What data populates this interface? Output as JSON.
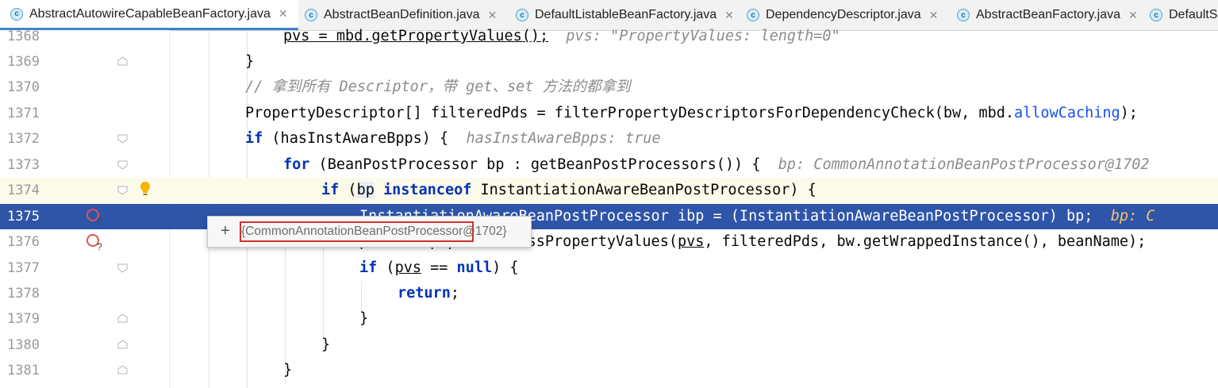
{
  "tabs": [
    {
      "label": "AbstractAutowireCapableBeanFactory.java",
      "active": true
    },
    {
      "label": "AbstractBeanDefinition.java",
      "active": false
    },
    {
      "label": "DefaultListableBeanFactory.java",
      "active": false
    },
    {
      "label": "DependencyDescriptor.java",
      "active": false
    },
    {
      "label": "AbstractBeanFactory.java",
      "active": false
    },
    {
      "label": "DefaultS",
      "active": false
    }
  ],
  "close_glyph": "✕",
  "class_icon_letter": "c",
  "lines": {
    "l1368": {
      "num": "1368",
      "code": "pvs = mbd.getPropertyValues();",
      "hint": "pvs: \"PropertyValues: length=0\""
    },
    "l1369": {
      "num": "1369",
      "code": "}"
    },
    "l1370": {
      "num": "1370",
      "comment": "// 拿到所有 Descriptor，带 get、set 方法的都拿到"
    },
    "l1371": {
      "num": "1371",
      "code_a": "PropertyDescriptor[] filteredPds = filterPropertyDescriptorsForDependencyCheck(bw, mbd.",
      "field": "allowCaching",
      "code_b": ");"
    },
    "l1372": {
      "num": "1372",
      "kw": "if",
      "code": " (hasInstAwareBpps) {",
      "hint": "hasInstAwareBpps: true"
    },
    "l1373": {
      "num": "1373",
      "kw": "for",
      "code": " (BeanPostProcessor bp : getBeanPostProcessors()) {",
      "hint": "bp: CommonAnnotationBeanPostProcessor@1702"
    },
    "l1374": {
      "num": "1374",
      "kw": "if",
      "code_a": " (",
      "var": "bp",
      "kw2": " instanceof",
      "code_b": " InstantiationAwareBeanPostProcessor) {"
    },
    "l1375": {
      "num": "1375",
      "code": "InstantiationAwareBeanPostProcessor ibp = (InstantiationAwareBeanPostProcessor) bp;",
      "hint": "bp: C"
    },
    "l1376": {
      "num": "1376",
      "code_a": "pvs",
      "code_b": " = ibp.postProcessPropertyValues(",
      "pvs_arg": "pvs",
      "code_c": ", filteredPds, bw.getWrappedInstance(), beanName);"
    },
    "l1377": {
      "num": "1377",
      "kw": "if",
      "code_a": " (",
      "var": "pvs",
      "code_b": " == ",
      "kw2": "null",
      "code_c": ") {"
    },
    "l1378": {
      "num": "1378",
      "kw": "return",
      "code": ";"
    },
    "l1379": {
      "num": "1379",
      "code": "}"
    },
    "l1380": {
      "num": "1380",
      "code": "}"
    },
    "l1381": {
      "num": "1381",
      "code": "}"
    }
  },
  "popup": {
    "expand": "+",
    "value": "{CommonAnnotationBeanPostProcessor@1702}"
  },
  "colors": {
    "keyword": "#0033b3",
    "selection": "#2e55a8",
    "current_line": "#fcfae9",
    "field": "#1750eb",
    "callout": "#d0312d"
  }
}
